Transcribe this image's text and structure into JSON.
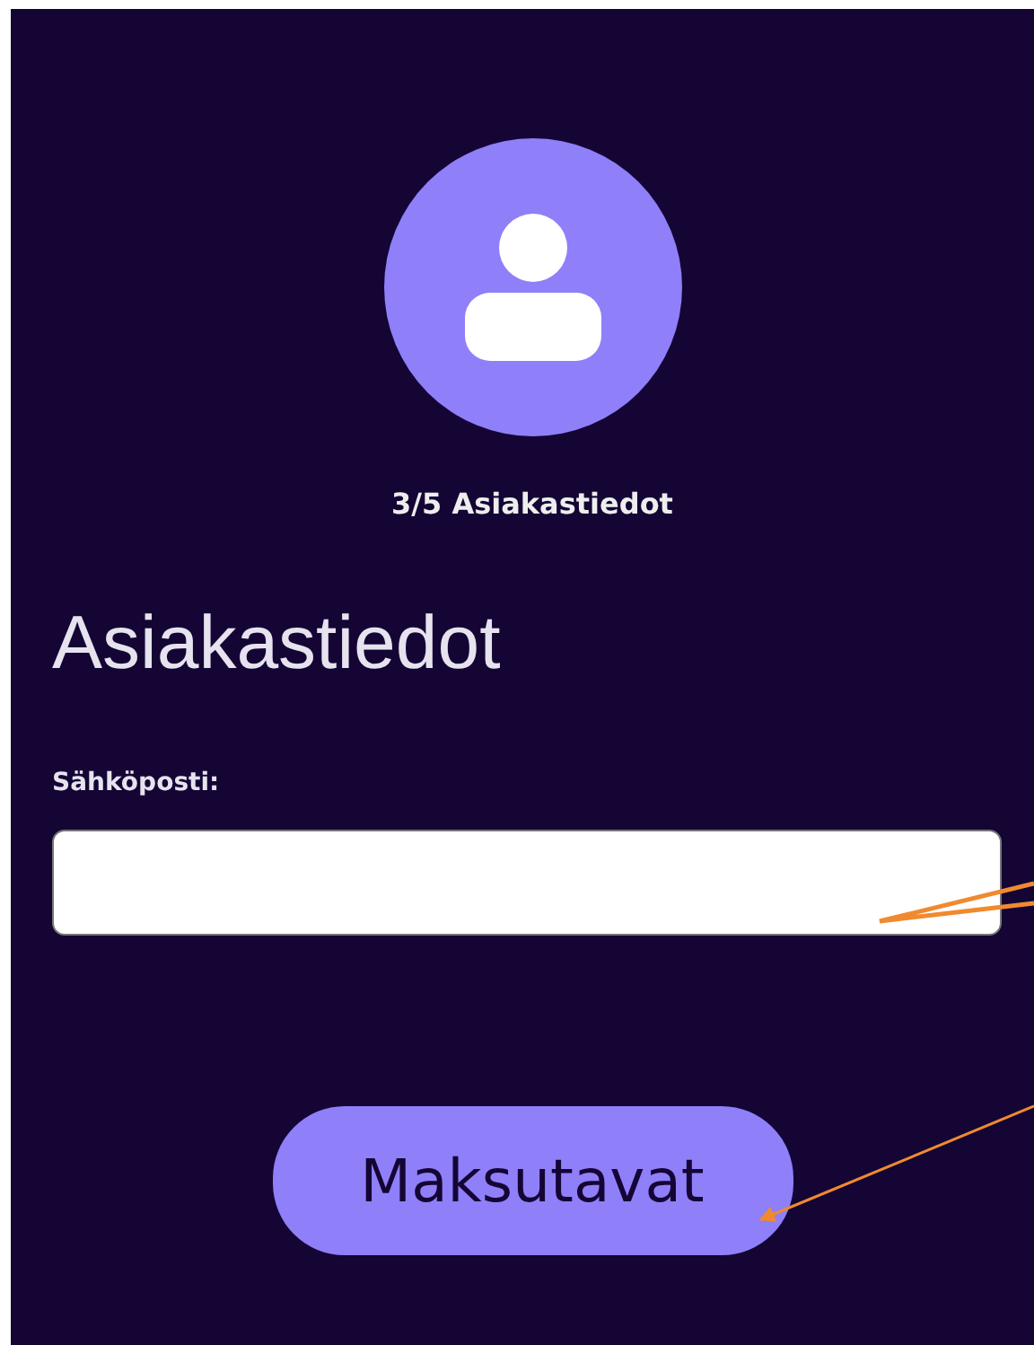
{
  "step": "3/5 Asiakastiedot",
  "heading": "Asiakastiedot",
  "email_field": {
    "label": "Sähköposti:"
  },
  "button": "Maksutavat"
}
